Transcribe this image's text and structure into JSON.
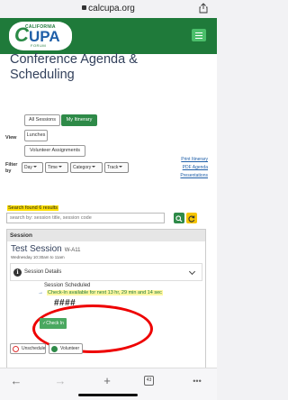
{
  "browser": {
    "url": "calcupa.org"
  },
  "header": {
    "logo": {
      "top_text": "CALIFORNIA",
      "mark_c": "C",
      "mark_upa": "UPA",
      "bottom_text": "FORUM"
    }
  },
  "page": {
    "title": "Conference Agenda & Scheduling"
  },
  "view": {
    "label": "View",
    "tabs": [
      "All Sessions",
      "My Itinerary",
      "Lunches",
      "Volunteer Assignments"
    ]
  },
  "filter": {
    "label": "Filter by",
    "selects": [
      "Day",
      "Time",
      "Category",
      "Track"
    ],
    "links": [
      "Print Itinerary",
      "PDF Agenda",
      "Presentations"
    ]
  },
  "search": {
    "results_text": "Search found 6 results",
    "placeholder": "search by: session title, session code"
  },
  "session_panel": {
    "header": "Session",
    "title": "Test Session",
    "code": "W-A11",
    "date": "Wednesday  10:30am to 11am",
    "details_label": "Session Details",
    "scheduled_label": "Session Scheduled",
    "checkin_notice": "Check-In available for next 13 hr, 29 min and 14 sec",
    "code_mask": "####",
    "checkin_button": "✓Check In",
    "actions": [
      "Unschedule",
      "Volunteer"
    ]
  },
  "toolbar": {
    "tab_count": "43",
    "more": "•••"
  },
  "colors": {
    "brand_green": "#1f7a3a",
    "highlight_yellow": "#ffe000",
    "annotation_red": "#e00000"
  }
}
